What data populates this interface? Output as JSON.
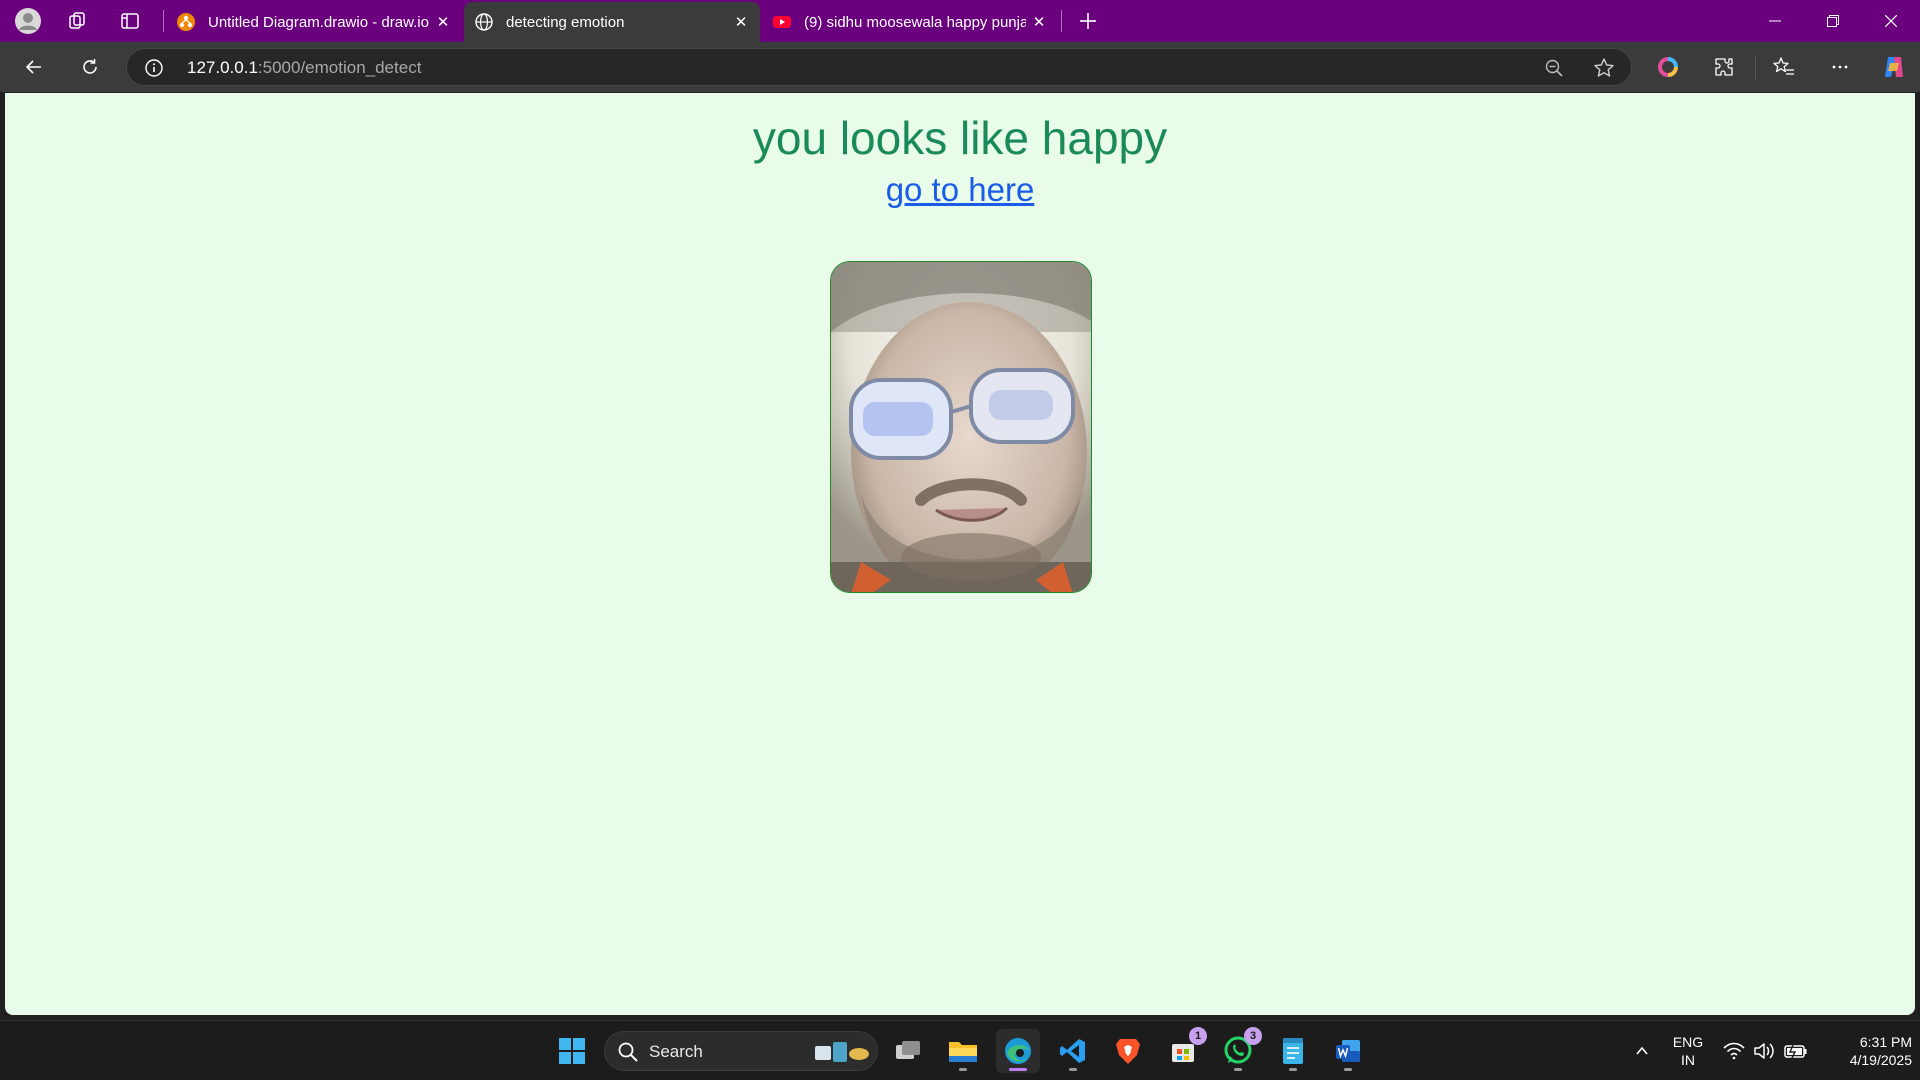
{
  "tabs": [
    {
      "title": "Untitled Diagram.drawio - draw.io",
      "icon": "drawio-icon"
    },
    {
      "title": "detecting emotion",
      "icon": "globe-icon"
    },
    {
      "title": "(9) sidhu moosewala happy punjabi",
      "icon": "youtube-icon"
    }
  ],
  "toolbar": {
    "url_host": "127.0.0.1",
    "url_path": ":5000/emotion_detect"
  },
  "page": {
    "heading": "you looks like happy",
    "link_text": "go to here",
    "photo_alt": "captured face image"
  },
  "taskbar": {
    "search_label": "Search",
    "store_badge": "1",
    "whatsapp_badge": "3",
    "lang_line1": "ENG",
    "lang_line2": "IN",
    "time": "6:31 PM",
    "date": "4/19/2025"
  },
  "colors": {
    "tabstrip": "#6b007f",
    "page_background": "#e9fce9",
    "heading": "#1b8a5a",
    "link": "#1a5ce8"
  }
}
